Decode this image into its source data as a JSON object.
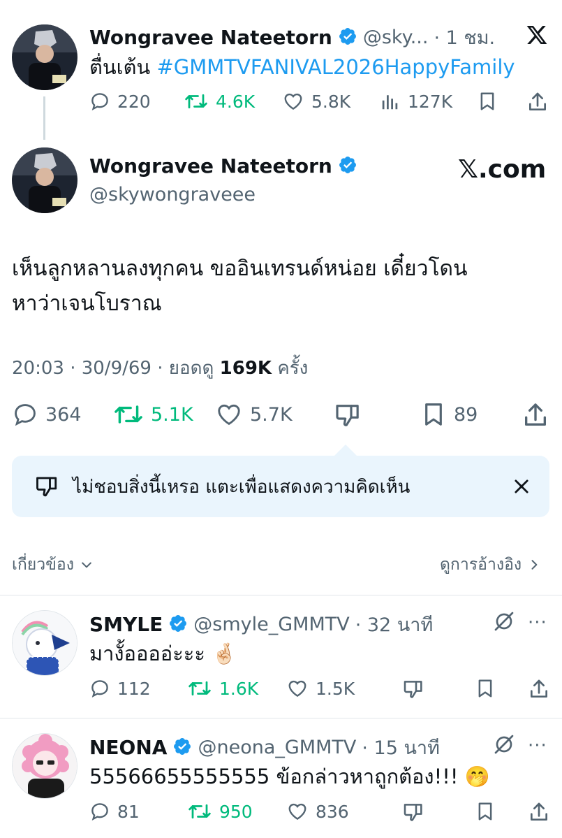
{
  "colors": {
    "accent": "#1d9bf0",
    "repost_green": "#00ba7c",
    "muted": "#536471",
    "callout_bg": "#eaf5fd"
  },
  "top_post": {
    "author_name": "Wongravee Nateetorn",
    "handle": "@sky...",
    "time": "· 1 ชม.",
    "text_prefix": "ตื่นเต้น ",
    "hashtag": "#GMMTVFANIVAL2026HappyFamily",
    "replies": "220",
    "reposts": "4.6K",
    "likes": "5.8K",
    "views": "127K",
    "brand_icon": "x-logo-icon"
  },
  "main_post": {
    "author_name": "Wongravee Nateetorn",
    "handle": "@skywongraveee",
    "watermark": "𝕏.com",
    "text_line1": "เห็นลูกหลานลงทุกคน ขออินเทรนด์หน่อย เดี๋ยวโดน",
    "text_line2": "หาว่าเจนโบราณ",
    "timestamp": "20:03 · 30/9/69 · ยอดดู ",
    "views": "169K",
    "views_suffix": " ครั้ง",
    "replies": "364",
    "reposts": "5.1K",
    "likes": "5.7K",
    "bookmarks": "89"
  },
  "callout": {
    "text": "ไม่ชอบสิ่งนี้เหรอ แตะเพื่อแสดงความคิดเห็น"
  },
  "sort_bar": {
    "left_label": "เกี่ยวข้อง",
    "right_label": "ดูการอ้างอิง"
  },
  "replies": [
    {
      "name": "SMYLE",
      "handle": "@smyle_GMMTV",
      "time": "· 32 นาที",
      "text": "มางั้ออออ่ะะะ",
      "emoji": "🤞🏻",
      "replies": "112",
      "reposts": "1.6K",
      "likes": "1.5K"
    },
    {
      "name": "NEONA",
      "handle": "@neona_GMMTV",
      "time": "· 15 นาที",
      "text": "55566655555555 ข้อกล่าวหาถูกต้อง!!!",
      "emoji": "🤭",
      "replies": "81",
      "reposts": "950",
      "likes": "836"
    }
  ]
}
